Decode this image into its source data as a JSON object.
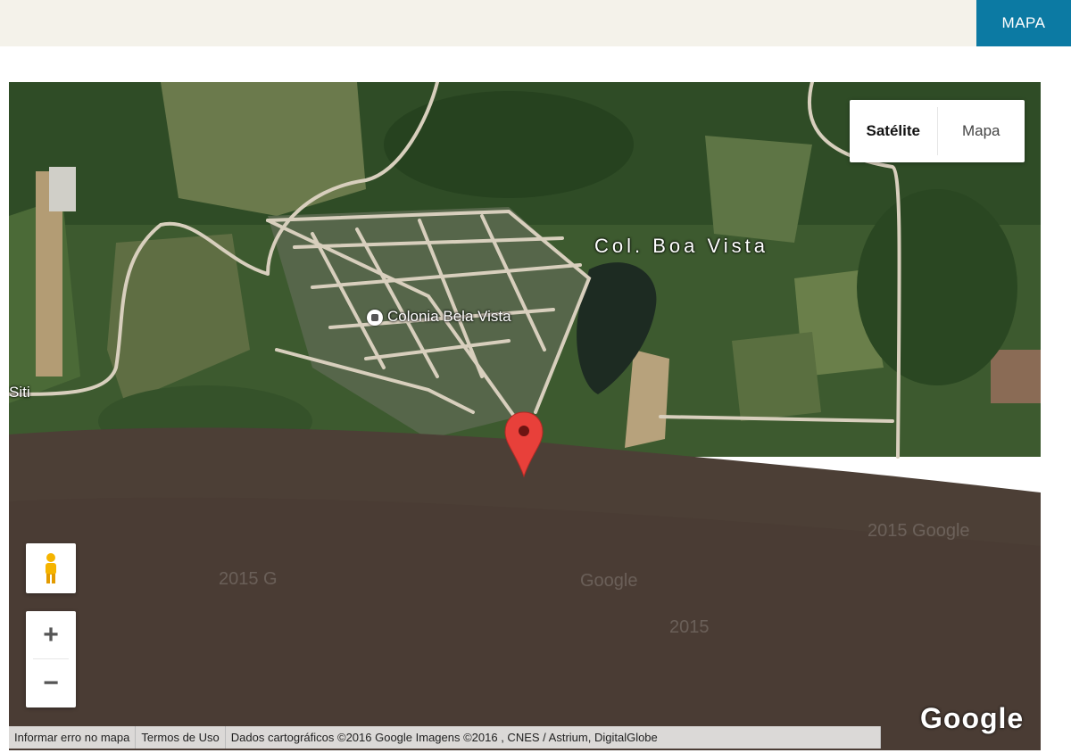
{
  "header": {
    "tab_label": "MAPA"
  },
  "map": {
    "type_control": {
      "options": [
        "Mapa",
        "Satélite"
      ],
      "active": "Satélite"
    },
    "labels": {
      "settlement": "Colonia Bela Vista",
      "area": "Col. Boa Vista",
      "edge_fragment": "Siti"
    },
    "watermarks": [
      "2015 Google",
      "2015 G",
      "Google",
      "2015"
    ],
    "zoom": {
      "in": "+",
      "out": "−"
    },
    "logo": "Google",
    "footer": {
      "attribution": "Dados cartográficos ©2016 Google Imagens ©2016 , CNES / Astrium, DigitalGlobe",
      "terms": "Termos de Uso",
      "report": "Informar erro no mapa"
    }
  }
}
